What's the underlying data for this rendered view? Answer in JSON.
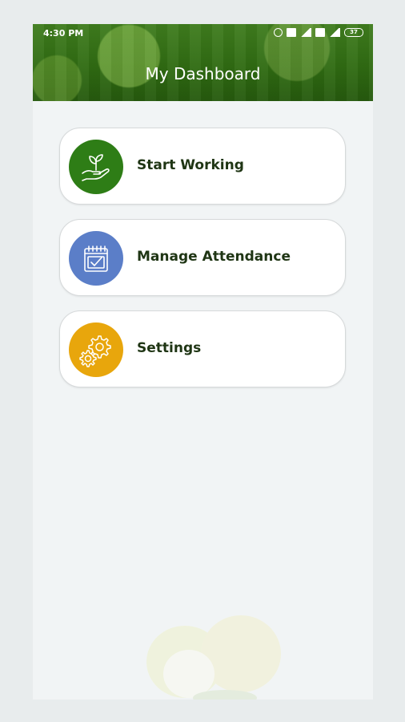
{
  "status_bar": {
    "time": "4:30 PM",
    "battery": "37"
  },
  "header": {
    "title": "My Dashboard"
  },
  "menu": {
    "items": [
      {
        "label": "Start Working",
        "icon": "plant-hand-icon",
        "color": "#2e7d16"
      },
      {
        "label": "Manage Attendance",
        "icon": "calendar-check-icon",
        "color": "#5b7ec8"
      },
      {
        "label": "Settings",
        "icon": "gears-icon",
        "color": "#e8a60c"
      }
    ]
  },
  "colors": {
    "header_green": "#2f6a12",
    "label_text": "#1f3514",
    "background": "#f1f4f5"
  }
}
